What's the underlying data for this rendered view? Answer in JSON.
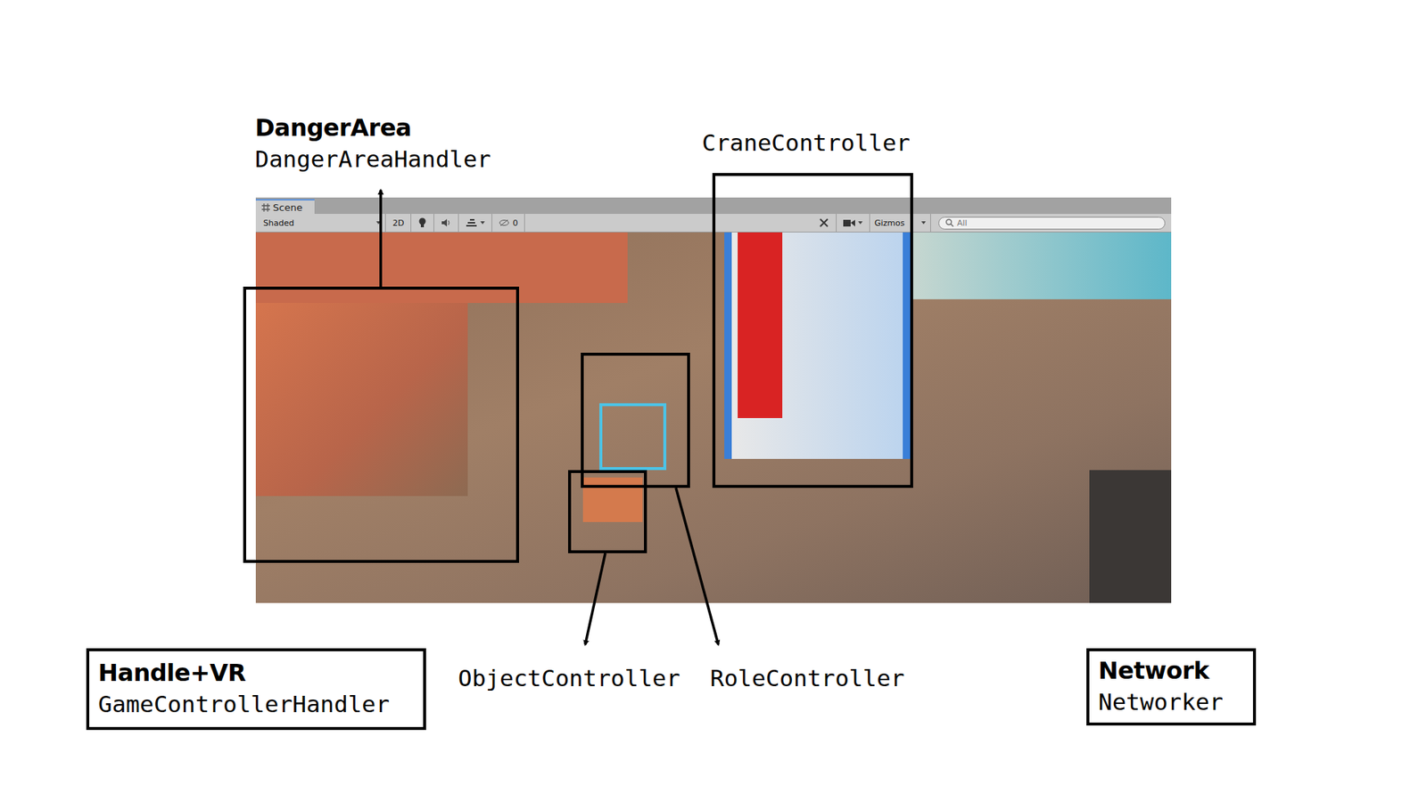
{
  "scene": {
    "tab": "Scene",
    "shading": "Shaded",
    "mode2d": "2D",
    "hidden_count": "0",
    "gizmos": "Gizmos",
    "search": {
      "placeholder": "All"
    }
  },
  "regions": [
    {
      "title": "DangerArea",
      "script": "DangerAreaHandler"
    },
    {
      "title": "",
      "script": "CraneController"
    },
    {
      "title": "",
      "script": "ObjectController"
    },
    {
      "title": "",
      "script": "RoleController"
    }
  ],
  "panels": [
    {
      "title": "Handle+VR",
      "script": "GameControllerHandler"
    },
    {
      "title": "Network",
      "script": "Networker"
    }
  ]
}
